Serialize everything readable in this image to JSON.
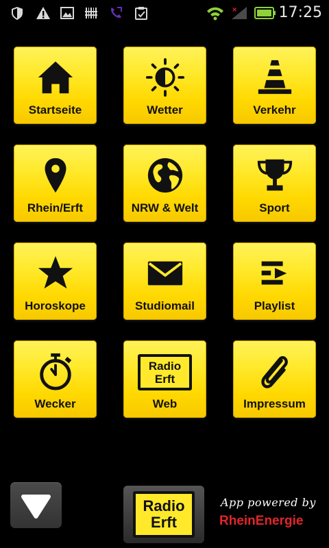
{
  "status_bar": {
    "time": "17:25",
    "icons": [
      "shield-icon",
      "warning-icon",
      "image-icon",
      "barcode-icon",
      "call-forward-icon",
      "clipboard-icon",
      "wifi-icon",
      "signal-icon",
      "battery-icon"
    ]
  },
  "tiles": [
    {
      "label": "Startseite",
      "icon": "home-icon"
    },
    {
      "label": "Wetter",
      "icon": "sun-icon"
    },
    {
      "label": "Verkehr",
      "icon": "traffic-cone-icon"
    },
    {
      "label": "Rhein/Erft",
      "icon": "map-pin-icon"
    },
    {
      "label": "NRW & Welt",
      "icon": "globe-icon"
    },
    {
      "label": "Sport",
      "icon": "trophy-icon"
    },
    {
      "label": "Horoskope",
      "icon": "star-icon"
    },
    {
      "label": "Studiomail",
      "icon": "envelope-icon"
    },
    {
      "label": "Playlist",
      "icon": "playlist-icon"
    },
    {
      "label": "Wecker",
      "icon": "stopwatch-icon"
    },
    {
      "label": "Web",
      "icon": "radio-erft-logo"
    },
    {
      "label": "Impressum",
      "icon": "paperclip-icon"
    }
  ],
  "logo": {
    "line1": "Radio",
    "line2": "Erft"
  },
  "footer": {
    "powered_by": "App powered by",
    "sponsor": "RheinEnergie",
    "sponsor_color": "#e0262b"
  },
  "colors": {
    "tile_yellow": "#ffe92a",
    "background": "#000000"
  }
}
